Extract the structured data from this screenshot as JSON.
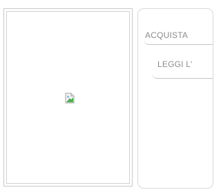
{
  "product": {
    "cover_image": {
      "state": "broken-image",
      "icon": "broken-image-icon"
    }
  },
  "actions": {
    "buy_label": "ACQUISTA",
    "read_label": "LEGGI L'"
  },
  "colors": {
    "border": "#c8c8c8",
    "button_text": "#8c8c8c",
    "background": "#ffffff"
  }
}
